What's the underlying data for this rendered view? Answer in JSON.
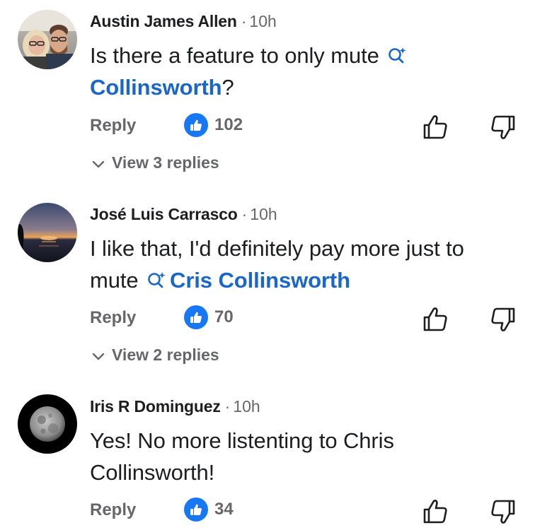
{
  "comments": [
    {
      "author": "Austin James Allen",
      "separator": "·",
      "time": "10h",
      "text_before": "Is there a feature to only mute",
      "mention": "Collinsworth",
      "text_after": "?",
      "avatar_icon": "avatar-couple-photo",
      "reply_label": "Reply",
      "like_count": "102",
      "view_replies_label": "View 3 replies"
    },
    {
      "author": "José Luis Carrasco",
      "separator": "·",
      "time": "10h",
      "text_before": "I like that, I'd definitely pay more just to mute",
      "mention": "Cris Collinsworth",
      "text_after": "",
      "avatar_icon": "avatar-sunset-photo",
      "reply_label": "Reply",
      "like_count": "70",
      "view_replies_label": "View 2 replies"
    },
    {
      "author": "Iris R Dominguez",
      "separator": "·",
      "time": "10h",
      "text": "Yes! No more listenting to Chris Collinsworth!",
      "avatar_icon": "avatar-moon-photo",
      "reply_label": "Reply",
      "like_count": "34"
    }
  ],
  "colors": {
    "mention": "#1b66c9",
    "like_badge": "#1877f2",
    "secondary_text": "#65676b",
    "primary_text": "#1c1e21"
  },
  "icons": [
    "search-sparkle-icon",
    "like-badge-icon",
    "thumbs-up-icon",
    "thumbs-down-icon",
    "chevron-down-icon"
  ]
}
